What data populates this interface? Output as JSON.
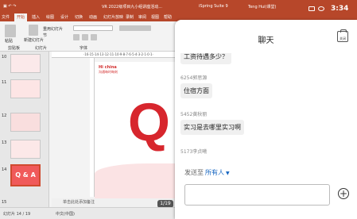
{
  "system": {
    "time": "3:34"
  },
  "ppt": {
    "title": "VR 2022级项目九小组讲座活动...",
    "app_name": "iSpring Suite 9",
    "user": "Teng Hui(课堂)",
    "tabs": [
      "文件",
      "开始",
      "插入",
      "绘图",
      "设计",
      "切换",
      "动画",
      "幻灯片放映",
      "录制",
      "审阅",
      "视图",
      "帮助",
      "iSpring Suite 9"
    ],
    "active_tab": "开始",
    "ribbon_groups": [
      "剪贴板",
      "幻灯片",
      "字体"
    ],
    "ribbon_labels": [
      "粘贴",
      "新建幻灯片",
      "重用幻灯片",
      "节"
    ],
    "slide_numbers": [
      "10",
      "11",
      "12",
      "13",
      "14",
      "15"
    ],
    "selected_thumb_text": "Q & A",
    "ruler_text": "·16·15·14·13·12·11·10·9·8·7·6·5·4·3·2·1·0·1·",
    "slide": {
      "brand_line1": "Hi china",
      "brand_line2": "沟通每时每刻",
      "big_letter": "Q"
    },
    "notes_placeholder": "单击此处添加备注",
    "page_badge": "1/19",
    "status_left": "幻灯片 14 / 19",
    "status_lang": "中文(中国)"
  },
  "chat": {
    "title": "聊天",
    "close_label": "关闭",
    "messages": [
      {
        "sender": "",
        "text": "工资待遇多少？"
      },
      {
        "sender": "6254郭思源",
        "text": "住宿方面"
      },
      {
        "sender": "5452黄秋丽",
        "text": "实习是去哪里实习啊"
      },
      {
        "sender": "5173李贞曦",
        "text": ""
      }
    ],
    "send_to_label": "发送至",
    "recipient": "所有人",
    "input_value": "",
    "add_button": "+"
  }
}
